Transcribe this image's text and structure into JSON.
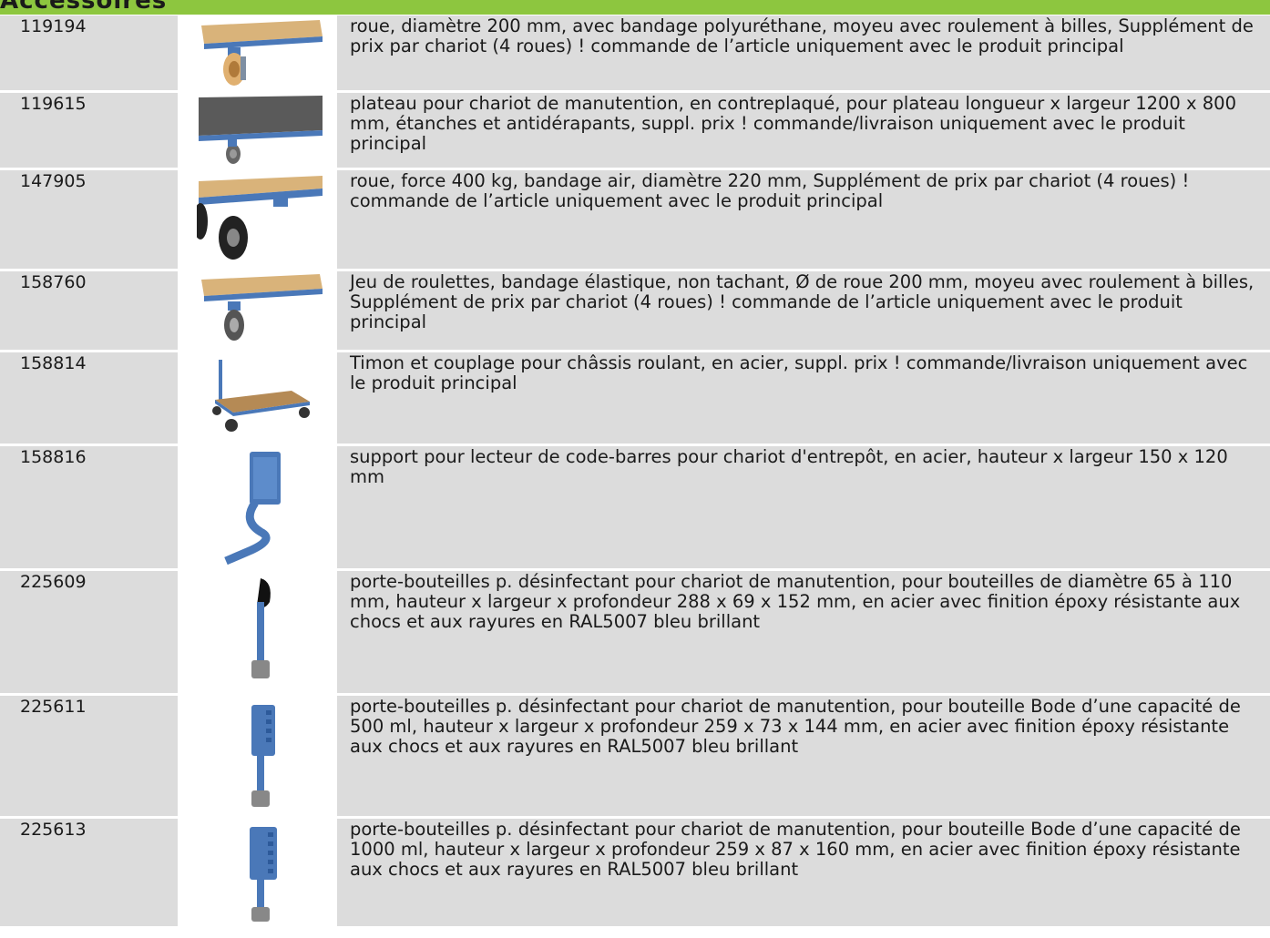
{
  "header": {
    "title": "Accessoires"
  },
  "rows": [
    {
      "number": "119194",
      "image_icon": "castor-wheel-icon",
      "description": "roue, diamètre 200 mm, avec bandage polyuréthane, moyeu avec roulement à billes, Supplément de prix par chariot (4 roues) ! commande de l’article uniquement avec le produit principal"
    },
    {
      "number": "119615",
      "image_icon": "plywood-platform-icon",
      "description": "plateau pour chariot de manutention, en contreplaqué, pour plateau longueur x largeur 1200 x 800 mm, étanches et antidérapants, suppl. prix ! commande/livraison uniquement avec le produit principal"
    },
    {
      "number": "147905",
      "image_icon": "pneumatic-wheel-icon",
      "description": "roue, force 400 kg, bandage air, diamètre 220 mm, Supplément de prix par chariot (4 roues) ! commande de l’article uniquement avec le produit principal"
    },
    {
      "number": "158760",
      "image_icon": "castor-set-icon",
      "description": "Jeu de roulettes, bandage élastique, non tachant, Ø de roue 200 mm, moyeu avec roulement à billes, Supplément de prix par chariot (4 roues) ! commande de l’article uniquement avec le produit principal"
    },
    {
      "number": "158814",
      "image_icon": "tow-bar-cart-icon",
      "description": "Timon et couplage pour châssis roulant, en acier, suppl. prix ! commande/livraison uniquement avec le produit principal"
    },
    {
      "number": "158816",
      "image_icon": "scanner-holder-icon",
      "description": "support pour lecteur de code-barres pour chariot d'entrepôt, en acier, hauteur x largeur 150 x 120 mm"
    },
    {
      "number": "225609",
      "image_icon": "bottle-holder-icon",
      "description": "porte-bouteilles p. désinfectant pour chariot de manutention, pour bouteilles de diamètre 65 à 110 mm, hauteur x largeur x profondeur 288 x 69 x 152 mm, en acier avec finition époxy résistante aux chocs et aux rayures en RAL5007 bleu brillant"
    },
    {
      "number": "225611",
      "image_icon": "bottle-holder-500-icon",
      "description": "porte-bouteilles p. désinfectant pour chariot de manutention, pour bouteille Bode d’une capacité de 500 ml, hauteur x largeur x profondeur 259 x 73 x 144 mm, en acier avec finition époxy résistante aux chocs et aux rayures en RAL5007 bleu brillant"
    },
    {
      "number": "225613",
      "image_icon": "bottle-holder-1000-icon",
      "description": "porte-bouteilles p. désinfectant pour chariot de manutention, pour bouteille Bode d’une capacité de 1000 ml, hauteur x largeur x profondeur 259 x 87 x 160 mm, en acier avec finition époxy résistante aux chocs et aux rayures en RAL5007 bleu brillant"
    }
  ],
  "colors": {
    "header_green": "#8dc63f",
    "row_grey": "#dcdcdc",
    "steel_blue": "#4a78b8",
    "wood": "#d9b37a"
  }
}
